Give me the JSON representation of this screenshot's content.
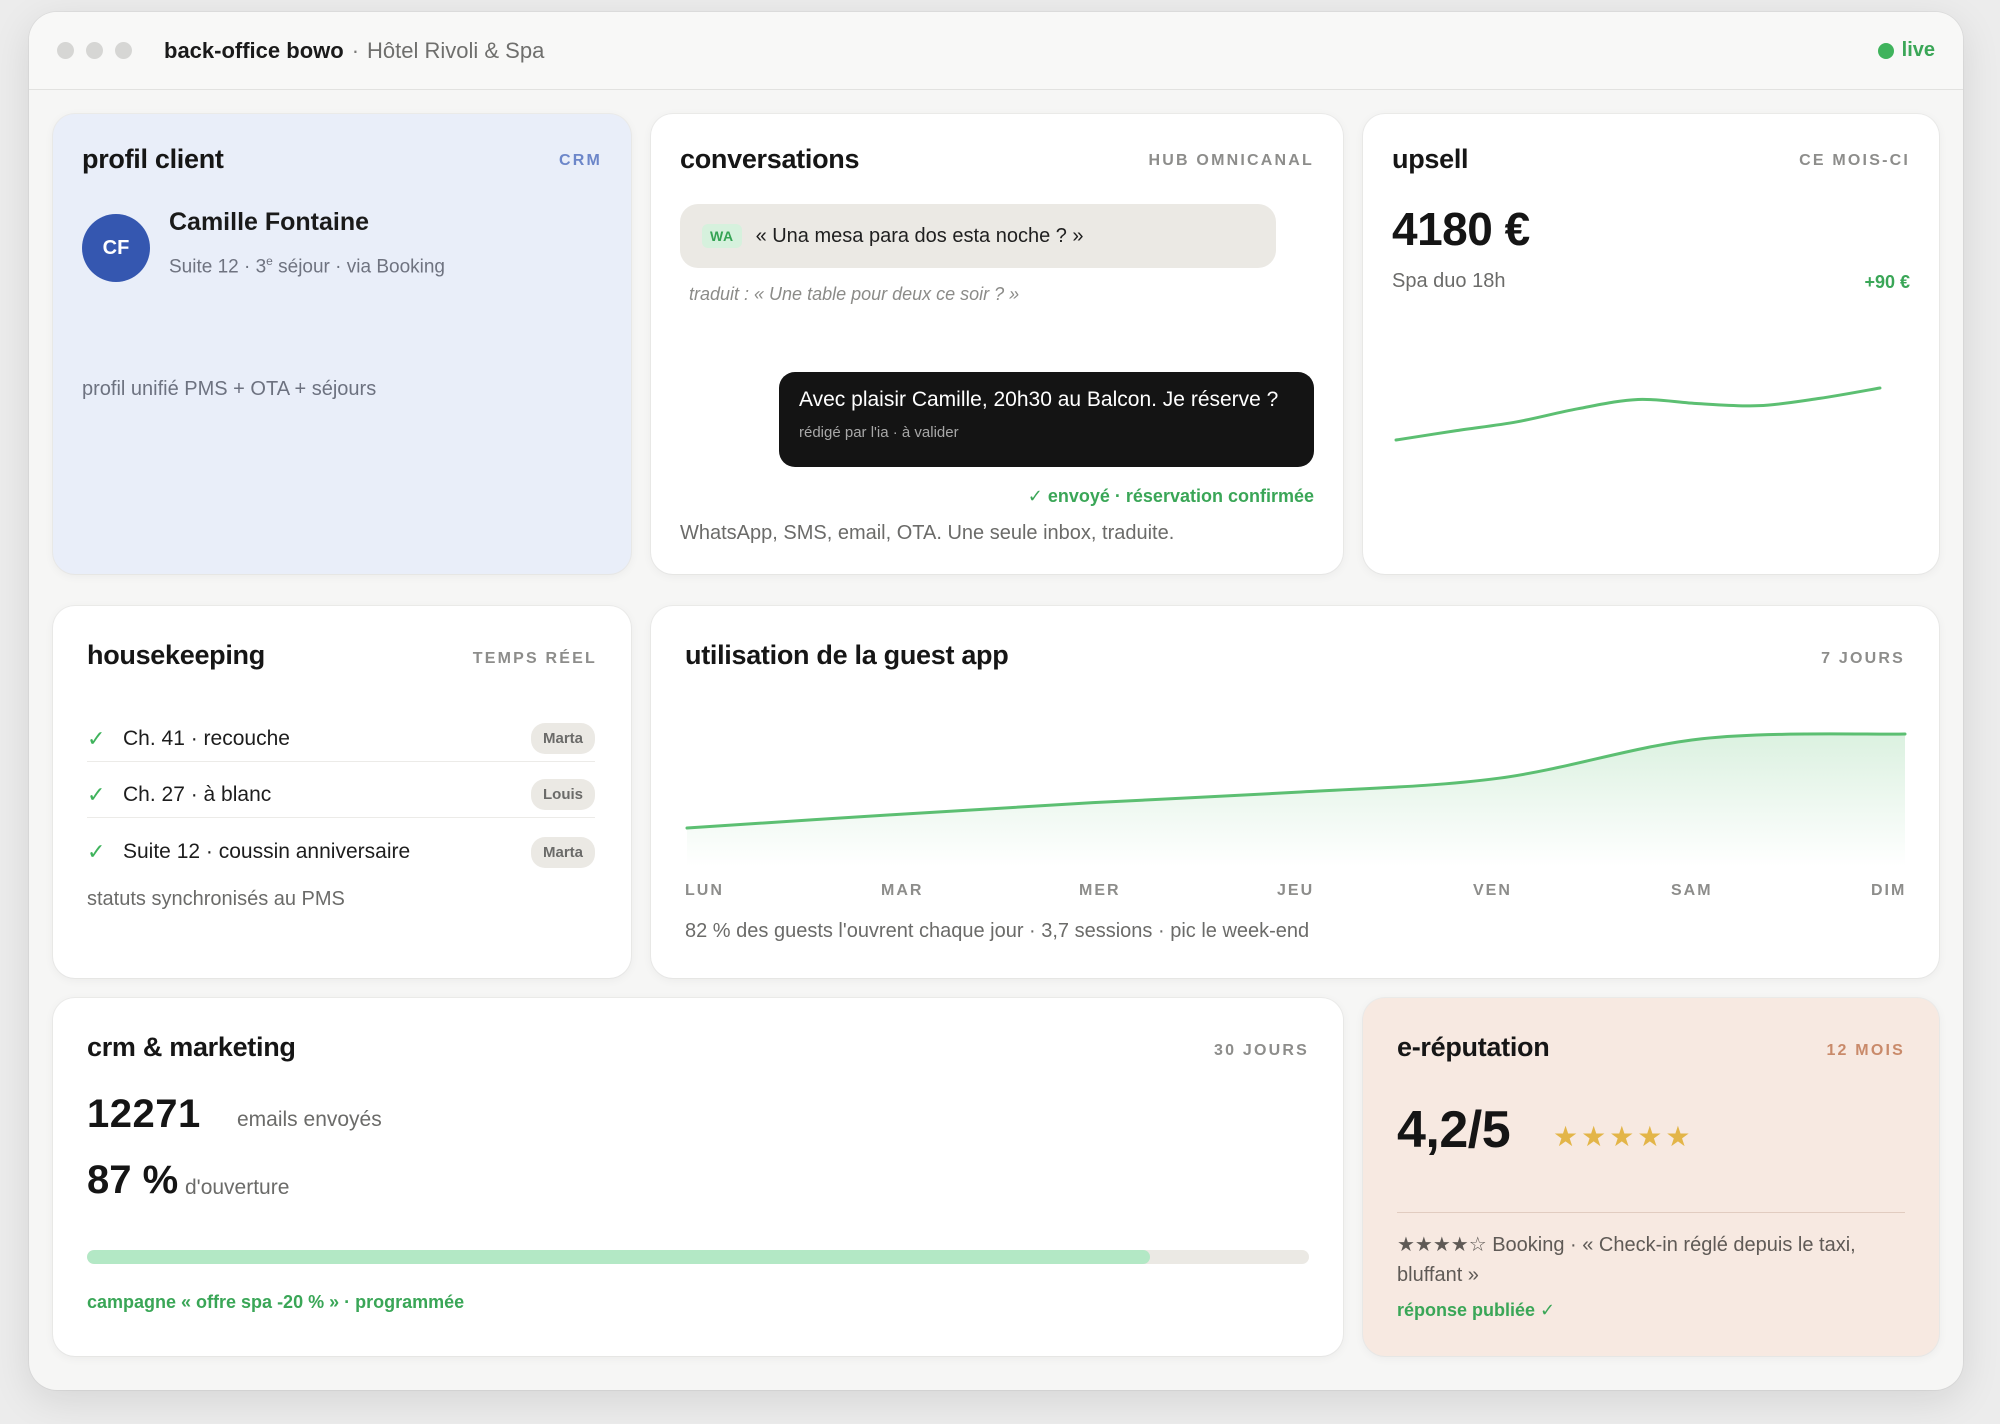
{
  "titlebar": {
    "app_name": "back-office bowo",
    "separator": "·",
    "hotel": "Hôtel Rivoli & Spa",
    "status": "live"
  },
  "profile": {
    "title": "profil client",
    "tag": "CRM",
    "initials": "CF",
    "name": "Camille Fontaine",
    "meta_prefix": "Suite 12 · 3",
    "meta_sup": "e",
    "meta_suffix": " séjour · via Booking",
    "note": "profil unifié PMS + OTA + séjours"
  },
  "conversations": {
    "title": "conversations",
    "tag": "HUB OMNICANAL",
    "incoming_badge": "WA",
    "incoming_text": "« Una mesa para dos esta noche ? »",
    "translated": "traduit : « Une table pour deux ce soir ? »",
    "reply_text": "Avec plaisir Camille, 20h30 au Balcon. Je réserve ?",
    "reply_sub": "rédigé par l'ia · à valider",
    "status": "✓ envoyé · réservation confirmée",
    "note": "WhatsApp, SMS, email, OTA. Une seule inbox, traduite."
  },
  "upsell": {
    "title": "upsell",
    "tag": "CE MOIS-CI",
    "amount": "4180 €",
    "item": "Spa duo 18h",
    "delta": "+90 €",
    "trend": [
      0.0,
      0.18,
      0.35,
      0.6,
      0.78,
      0.7,
      0.66,
      0.8,
      1.0
    ]
  },
  "housekeeping": {
    "title": "housekeeping",
    "tag": "TEMPS RÉEL",
    "rows": [
      {
        "label": "Ch. 41 · recouche",
        "badge": "Marta"
      },
      {
        "label": "Ch. 27 · à blanc",
        "badge": "Louis"
      },
      {
        "label": "Suite 12 · coussin anniversaire",
        "badge": "Marta"
      }
    ],
    "note": "statuts synchronisés au PMS"
  },
  "guest_app": {
    "title": "utilisation de la guest app",
    "tag": "7 JOURS",
    "days": [
      "LUN",
      "MAR",
      "MER",
      "JEU",
      "VEN",
      "SAM",
      "DIM"
    ],
    "trend": [
      0.0,
      0.14,
      0.27,
      0.38,
      0.53,
      0.95,
      1.0
    ],
    "note": "82 % des guests l'ouvrent chaque jour · 3,7 sessions · pic le week-end"
  },
  "crm": {
    "title": "crm & marketing",
    "tag": "30 JOURS",
    "emails_sent": "12271",
    "emails_sent_label": "emails envoyés",
    "open_rate": "87 %",
    "open_rate_label": "d'ouverture",
    "progress": 0.87,
    "campaign": "campagne « offre spa -20 % » · programmée"
  },
  "reputation": {
    "title": "e-réputation",
    "tag": "12 MOIS",
    "score": "4,2/5",
    "stars": "★★★★★",
    "review": "★★★★☆ Booking · « Check-in réglé depuis le taxi, bluffant »",
    "reply": "réponse publiée ✓"
  },
  "colors": {
    "accent_green": "#3aa657",
    "profile_bg": "#e9eef9",
    "avatar_blue": "#3557b0",
    "reputation_bg": "#f7e9e1",
    "star_gold": "#e3b548"
  }
}
